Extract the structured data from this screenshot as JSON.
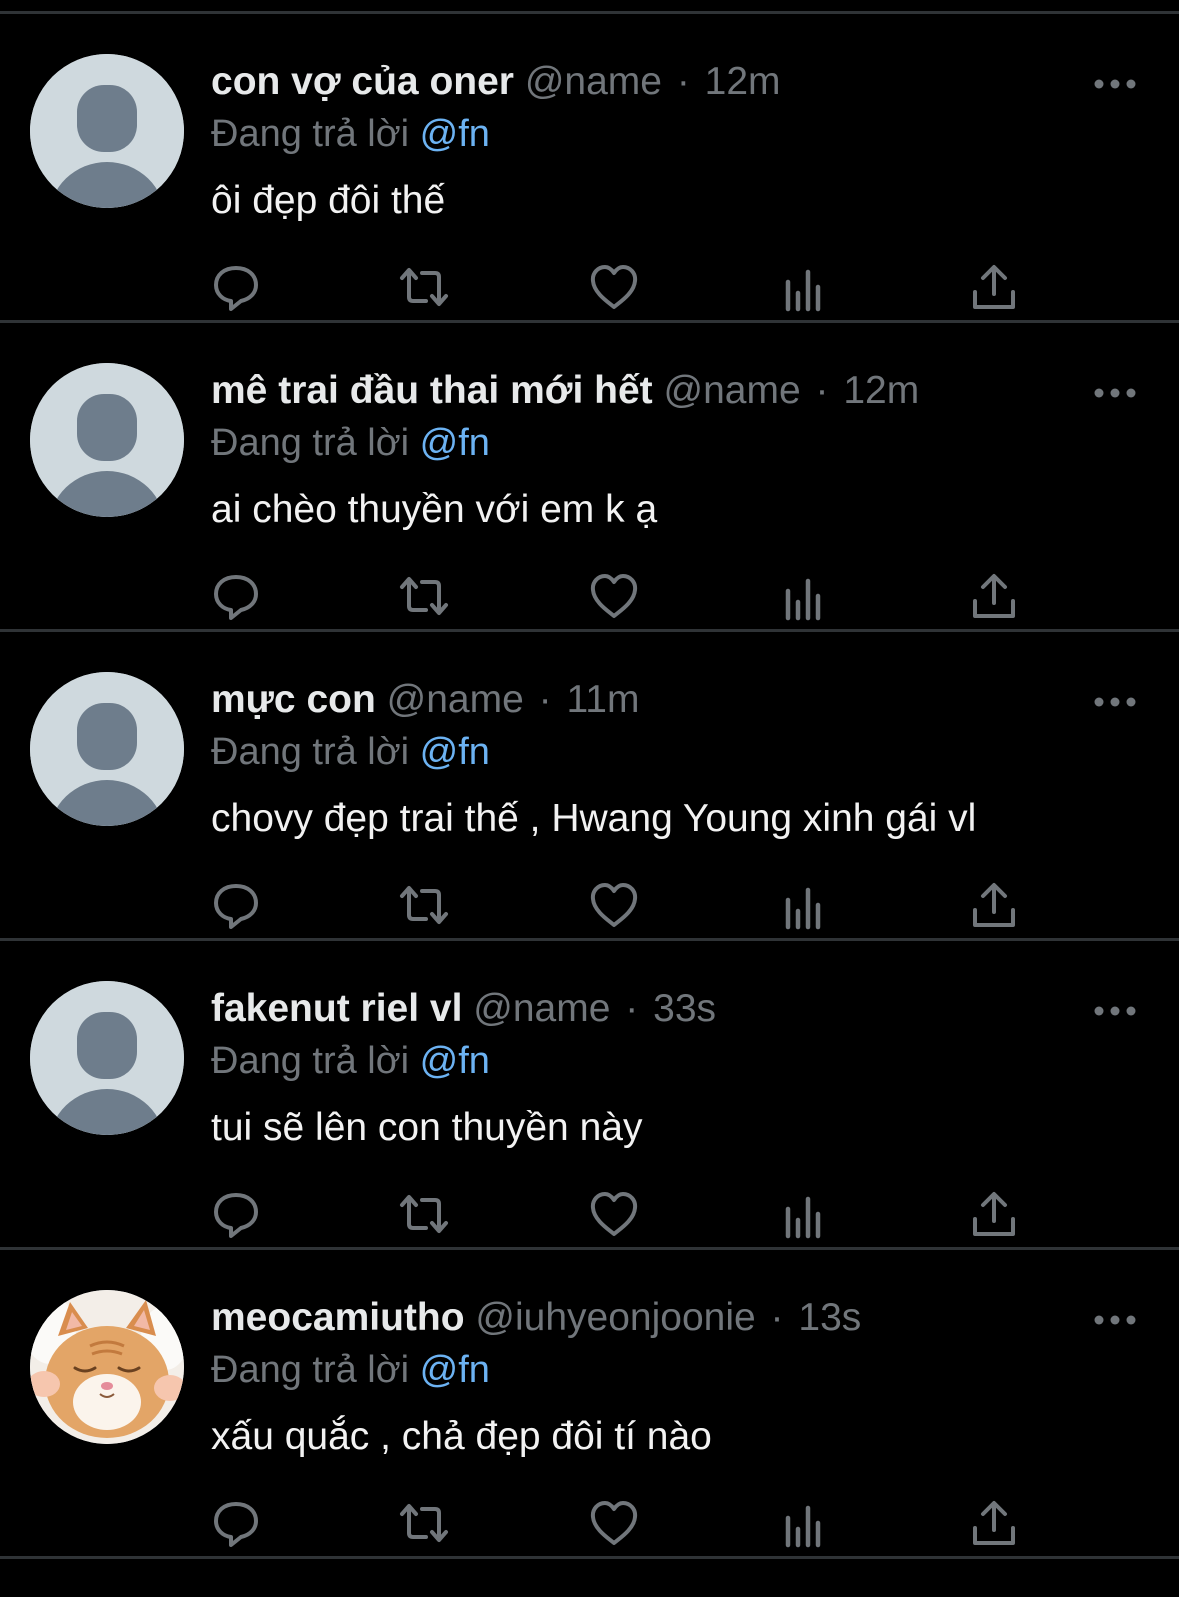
{
  "reply_prefix": "Đang trả lời",
  "reply_mention": "@fn",
  "colors": {
    "background": "#000000",
    "divider": "#2F3336",
    "primary_text": "#E7E9EA",
    "secondary_text": "#71767B",
    "mention": "#6CB2F2",
    "avatar_placeholder": "#CFD9DE",
    "avatar_figure": "#6E7D8C"
  },
  "actions": [
    {
      "icon": "reply-icon"
    },
    {
      "icon": "retweet-icon"
    },
    {
      "icon": "like-icon"
    },
    {
      "icon": "analytics-icon"
    },
    {
      "icon": "share-icon"
    }
  ],
  "replies": [
    {
      "display_name": "con vợ của oner",
      "handle": "@name",
      "separator": "·",
      "time": "12m",
      "text": "ôi đẹp đôi thế",
      "avatar": "default-avatar-icon"
    },
    {
      "display_name": "mê trai đầu thai mới hết",
      "handle": "@name",
      "separator": "·",
      "time": "12m",
      "text": "ai chèo thuyền với em k ạ",
      "avatar": "default-avatar-icon"
    },
    {
      "display_name": "mực con",
      "handle": "@name",
      "separator": "·",
      "time": "11m",
      "text": "chovy đẹp trai thế , Hwang Young xinh gái vl",
      "avatar": "default-avatar-icon"
    },
    {
      "display_name": "fakenut riel vl",
      "handle": "@name",
      "separator": "·",
      "time": "33s",
      "text": "tui sẽ lên con thuyền này",
      "avatar": "default-avatar-icon"
    },
    {
      "display_name": "meocamiutho",
      "handle": "@iuhyeonjoonie",
      "separator": "·",
      "time": "13s",
      "text": "xấu quắc , chả đẹp đôi tí nào",
      "avatar": "kitten-photo-avatar"
    }
  ]
}
